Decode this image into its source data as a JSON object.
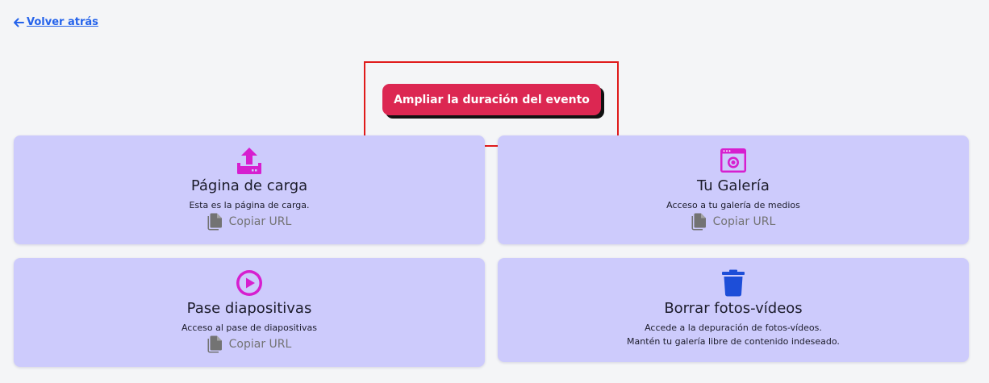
{
  "nav": {
    "back_label": "Volver atrás"
  },
  "extend_button": {
    "label": "Ampliar la duración del evento"
  },
  "cards": [
    {
      "title": "Página de carga",
      "description": "Esta es la página de carga.",
      "copy_label": "Copiar URL",
      "icon": "upload-icon"
    },
    {
      "title": "Tu Galería",
      "description": "Acceso a tu galería de medios",
      "copy_label": "Copiar URL",
      "icon": "gallery-icon"
    },
    {
      "title": "Pase diapositivas",
      "description": "Acceso al pase de diapositivas",
      "copy_label": "Copiar URL",
      "icon": "play-icon"
    },
    {
      "title": "Borrar fotos-vídeos",
      "description": "Accede a la depuración de fotos-vídeos.",
      "description_line2": "Mantén tu galería libre de contenido indeseado.",
      "icon": "trash-icon"
    }
  ],
  "colors": {
    "accent_button": "#dc2752",
    "card_bg": "#cdcbfc",
    "icon_magenta": "#d61fcf",
    "icon_blue": "#1d4ed8",
    "link": "#2563eb",
    "highlight": "#e01b1b"
  }
}
